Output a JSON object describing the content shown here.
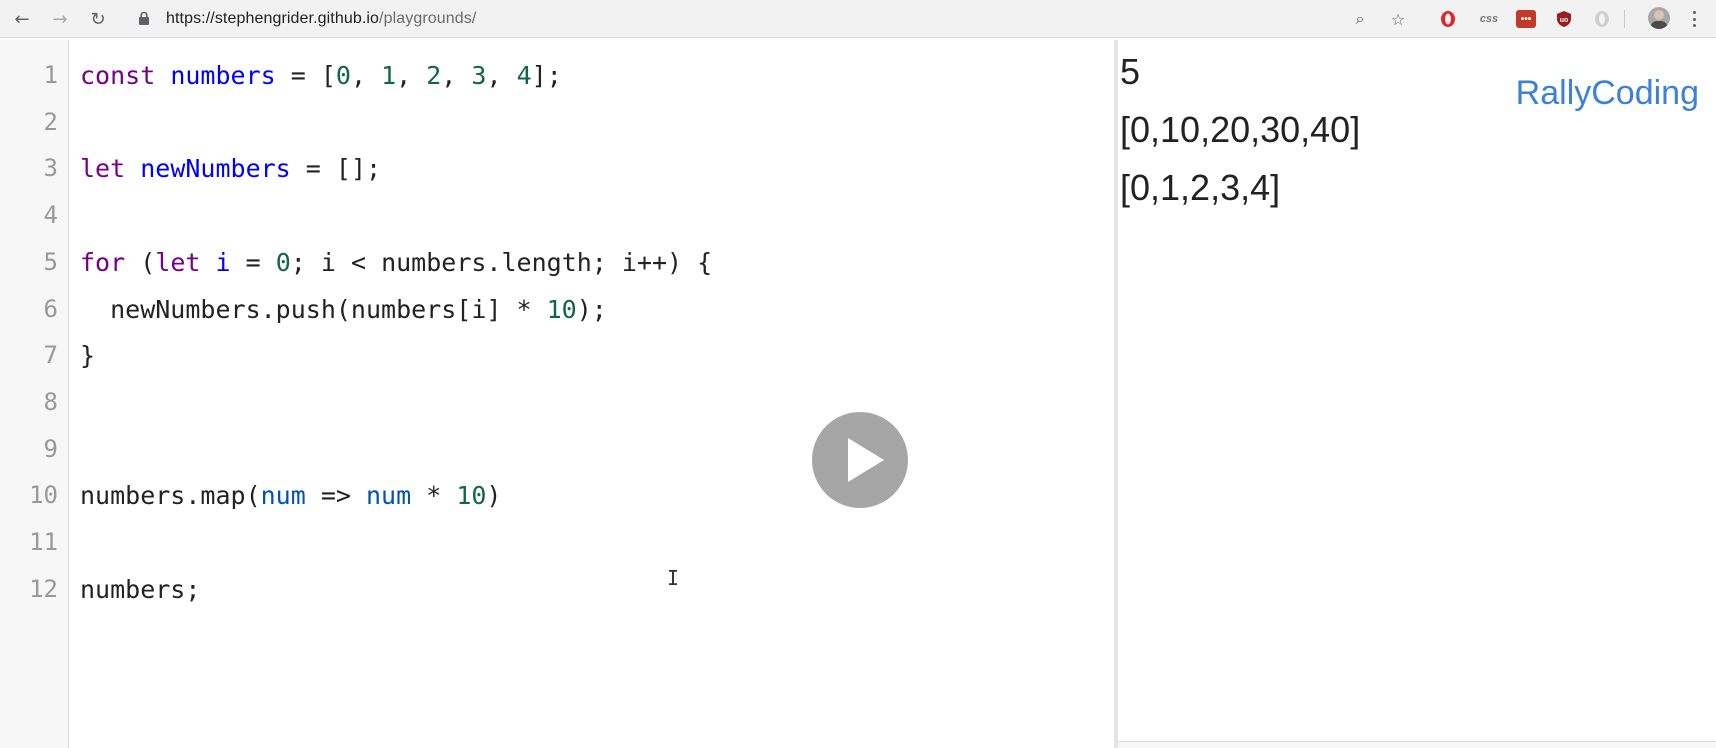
{
  "browser": {
    "url_main": "https://stephengrider.github.io",
    "url_path": "/playgrounds/",
    "back_glyph": "←",
    "forward_glyph": "→",
    "reload_glyph": "↻",
    "zoom_glyph": "⌕",
    "star_glyph": "☆",
    "ext_css_label": "css",
    "ext_red_label": "•••"
  },
  "editor": {
    "line_numbers": [
      "1",
      "2",
      "3",
      "4",
      "5",
      "6",
      "7",
      "8",
      "9",
      "10",
      "11",
      "12"
    ],
    "lines": [
      [
        {
          "t": "const ",
          "c": "kw"
        },
        {
          "t": "numbers",
          "c": "def"
        },
        {
          "t": " = [",
          "c": ""
        },
        {
          "t": "0",
          "c": "num"
        },
        {
          "t": ", ",
          "c": ""
        },
        {
          "t": "1",
          "c": "num"
        },
        {
          "t": ", ",
          "c": ""
        },
        {
          "t": "2",
          "c": "num"
        },
        {
          "t": ", ",
          "c": ""
        },
        {
          "t": "3",
          "c": "num"
        },
        {
          "t": ", ",
          "c": ""
        },
        {
          "t": "4",
          "c": "num"
        },
        {
          "t": "];",
          "c": ""
        }
      ],
      [],
      [
        {
          "t": "let ",
          "c": "kw"
        },
        {
          "t": "newNumbers",
          "c": "def"
        },
        {
          "t": " = [];",
          "c": ""
        }
      ],
      [],
      [
        {
          "t": "for",
          "c": "kw"
        },
        {
          "t": " (",
          "c": ""
        },
        {
          "t": "let ",
          "c": "kw"
        },
        {
          "t": "i",
          "c": "def"
        },
        {
          "t": " = ",
          "c": ""
        },
        {
          "t": "0",
          "c": "num"
        },
        {
          "t": "; i < numbers.length; i++) {",
          "c": ""
        }
      ],
      [
        {
          "t": "  newNumbers.push(numbers[i] * ",
          "c": ""
        },
        {
          "t": "10",
          "c": "num"
        },
        {
          "t": ");",
          "c": ""
        }
      ],
      [
        {
          "t": "}",
          "c": ""
        }
      ],
      [],
      [],
      [
        {
          "t": "numbers.map(",
          "c": ""
        },
        {
          "t": "num",
          "c": "var2"
        },
        {
          "t": " => ",
          "c": ""
        },
        {
          "t": "num",
          "c": "var2"
        },
        {
          "t": " * ",
          "c": ""
        },
        {
          "t": "10",
          "c": "num"
        },
        {
          "t": ")",
          "c": ""
        }
      ],
      [],
      [
        {
          "t": "numbers;",
          "c": ""
        }
      ]
    ]
  },
  "output": {
    "lines": [
      "5",
      "[0,10,20,30,40]",
      "[0,1,2,3,4]"
    ],
    "brand": "RallyCoding"
  },
  "overlay": {
    "cursor_glyph": "I"
  }
}
